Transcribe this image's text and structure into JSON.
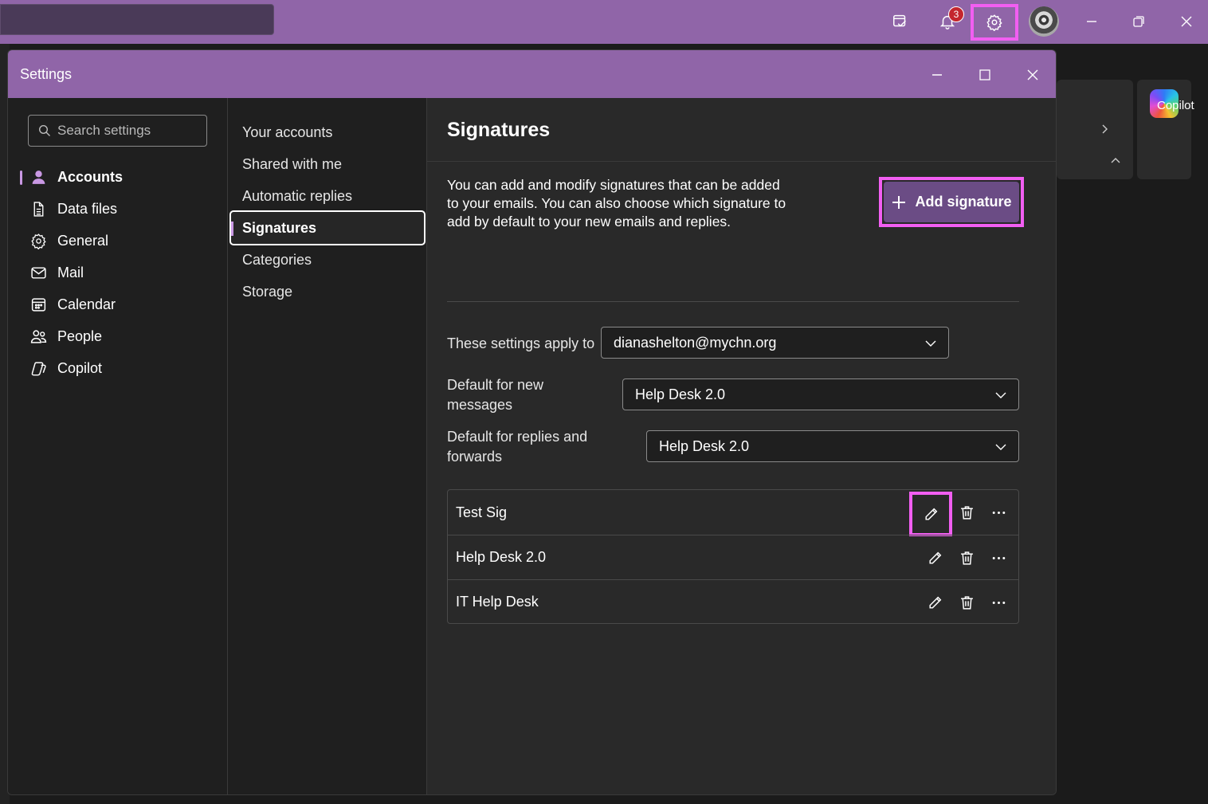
{
  "app": {
    "notification_count": "3",
    "icons": [
      "my-day-icon",
      "bell-icon",
      "gear-icon",
      "avatar",
      "minimize-icon",
      "restore-icon",
      "close-icon"
    ],
    "copilot_label": "Copilot",
    "highlight_color": "#f25ef2",
    "accent_color": "#9065a8"
  },
  "dialog": {
    "title": "Settings",
    "search_placeholder": "Search settings",
    "nav": [
      {
        "label": "Accounts",
        "icon": "person-icon",
        "active": true
      },
      {
        "label": "Data files",
        "icon": "document-icon"
      },
      {
        "label": "General",
        "icon": "gear-icon"
      },
      {
        "label": "Mail",
        "icon": "mail-icon"
      },
      {
        "label": "Calendar",
        "icon": "calendar-icon"
      },
      {
        "label": "People",
        "icon": "people-icon"
      },
      {
        "label": "Copilot",
        "icon": "copilot-icon"
      }
    ],
    "subnav": [
      {
        "label": "Your accounts"
      },
      {
        "label": "Shared with me"
      },
      {
        "label": "Automatic replies"
      },
      {
        "label": "Signatures",
        "active": true
      },
      {
        "label": "Categories"
      },
      {
        "label": "Storage"
      }
    ],
    "signatures": {
      "title": "Signatures",
      "description": "You can add and modify signatures that can be added to your emails. You can also choose which signature to add by default to your new emails and replies.",
      "add_button": "Add signature",
      "apply_to_label": "These settings apply to",
      "apply_to_value": "dianashelton@mychn.org",
      "default_new_label": "Default for new messages",
      "default_new_value": "Help Desk 2.0",
      "default_reply_label": "Default for replies and forwards",
      "default_reply_value": "Help Desk 2.0",
      "list": [
        {
          "name": "Test Sig"
        },
        {
          "name": "Help Desk 2.0"
        },
        {
          "name": "IT Help Desk"
        }
      ]
    }
  }
}
